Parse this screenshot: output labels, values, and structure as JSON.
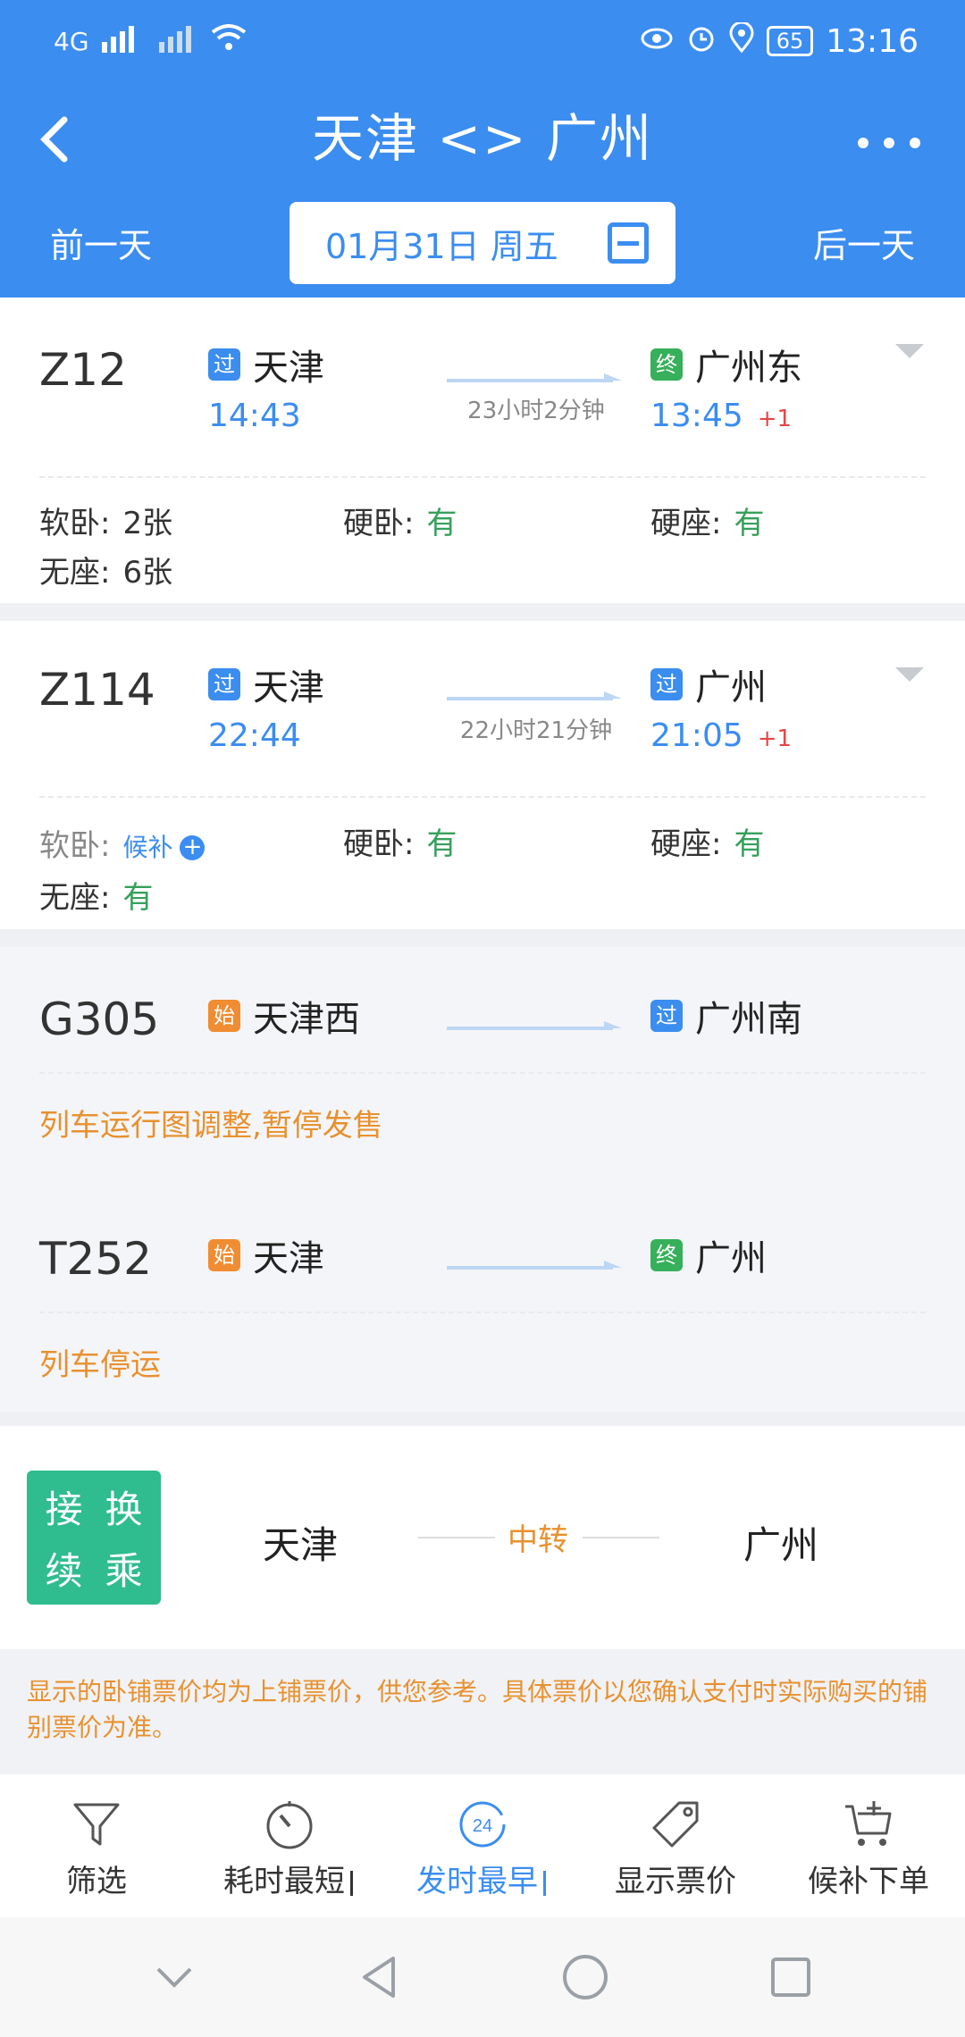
{
  "status": {
    "network": "4G",
    "battery": "65",
    "time": "13:16"
  },
  "header": {
    "title": "天津 <> 广州",
    "prev_day": "前一天",
    "next_day": "后一天",
    "date": "01月31日 周五"
  },
  "trains": [
    {
      "no": "Z12",
      "from_badge": "过",
      "from": "天津",
      "dep": "14:43",
      "duration": "23小时2分钟",
      "to_badge": "终",
      "to": "广州东",
      "arr": "13:45",
      "plus": "+1",
      "seats": [
        {
          "label": "软卧:",
          "value": "2张"
        },
        {
          "label": "硬卧:",
          "value": "有"
        },
        {
          "label": "硬座:",
          "value": "有"
        },
        {
          "label": "无座:",
          "value": "6张"
        }
      ]
    },
    {
      "no": "Z114",
      "from_badge": "过",
      "from": "天津",
      "dep": "22:44",
      "duration": "22小时21分钟",
      "to_badge": "过",
      "to": "广州",
      "arr": "21:05",
      "plus": "+1",
      "seats": [
        {
          "label": "软卧:",
          "value": "候补"
        },
        {
          "label": "硬卧:",
          "value": "有"
        },
        {
          "label": "硬座:",
          "value": "有"
        },
        {
          "label": "无座:",
          "value": "有"
        }
      ]
    },
    {
      "no": "G305",
      "from_badge": "始",
      "from": "天津西",
      "to_badge": "过",
      "to": "广州南",
      "note": "列车运行图调整,暂停发售"
    },
    {
      "no": "T252",
      "from_badge": "始",
      "from": "天津",
      "to_badge": "终",
      "to": "广州",
      "note": "列车停运"
    }
  ],
  "transfer": {
    "box": [
      "接",
      "换",
      "续",
      "乘"
    ],
    "from": "天津",
    "mid": "中转",
    "to": "广州"
  },
  "notice": "显示的卧铺票价均为上铺票价，供您参考。具体票价以您确认支付时实际购买的铺别票价为准。",
  "bottom_tabs": [
    {
      "label": "筛选",
      "icon": "filter-icon"
    },
    {
      "label": "耗时最短",
      "icon": "timer-icon"
    },
    {
      "label": "发时最早",
      "icon": "clock-24-icon",
      "active": true
    },
    {
      "label": "显示票价",
      "icon": "price-tag-icon"
    },
    {
      "label": "候补下单",
      "icon": "cart-add-icon"
    }
  ],
  "clock_24_text": "24",
  "colors": {
    "primary": "#3b8df0",
    "green": "#36a05a",
    "orange": "#e8912f",
    "red": "#e64545",
    "transfer": "#2fbc8e"
  }
}
